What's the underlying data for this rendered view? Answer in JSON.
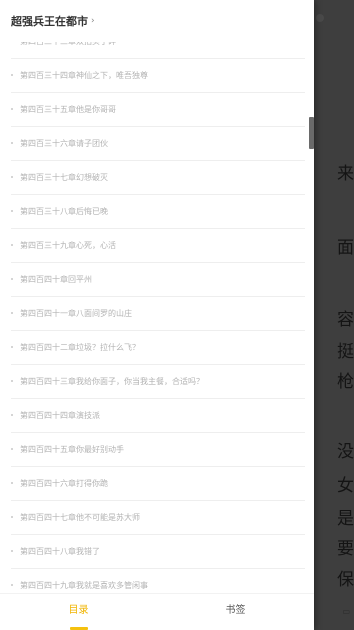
{
  "app": {
    "book_title": "超强兵王在都市",
    "tabs": [
      {
        "label": "目录",
        "active": true
      },
      {
        "label": "书签",
        "active": false
      }
    ],
    "accent_color": "#f5c10e"
  },
  "toc": {
    "chapters": [
      "第四百三十三章双拍买了碎",
      "第四百三十四章神仙之下，唯吾独尊",
      "第四百三十五章他是你哥哥",
      "第四百三十六章请子团伙",
      "第四百三十七章幻想破灭",
      "第四百三十八章后悔已晚",
      "第四百三十九章心死，心活",
      "第四百四十章回平州",
      "第四百四十一章八面间罗的山庄",
      "第四百四十二章垃圾？拉什么飞？",
      "第四百四十三章我给你面子，你当我主餐，合适吗？",
      "第四百四十四章演技派",
      "第四百四十五章你最好别动手",
      "第四百四十六章打得你跪",
      "第四百四十七章他不可能是苏大师",
      "第四百四十八章我错了",
      "第四百四十九章我就是喜欢多管闲事"
    ]
  },
  "reader": {
    "visible_fragments": [
      "来",
      "面",
      "容",
      "挺",
      "枪",
      "没",
      "女",
      "是",
      "要",
      "保"
    ]
  }
}
